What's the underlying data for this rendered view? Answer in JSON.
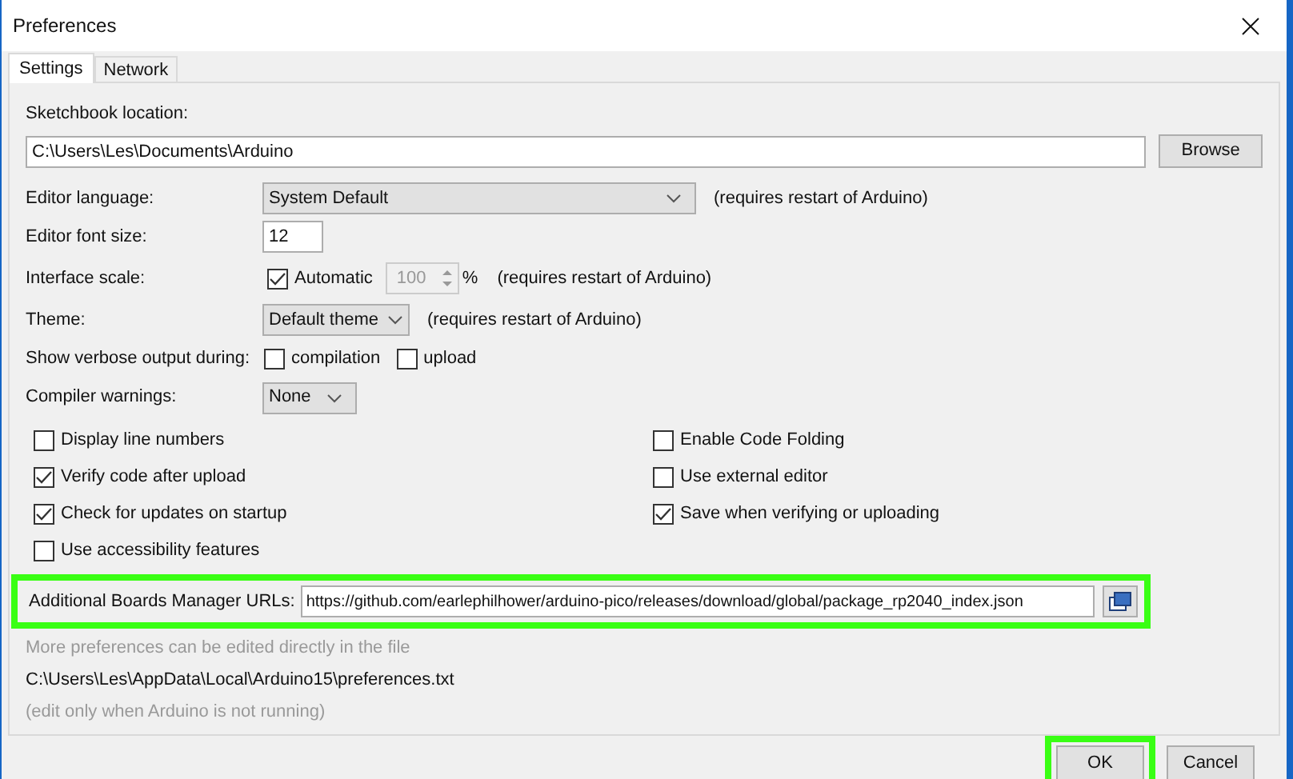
{
  "window": {
    "title": "Preferences"
  },
  "tabs": [
    {
      "label": "Settings",
      "selected": true
    },
    {
      "label": "Network",
      "selected": false
    }
  ],
  "sketchbook": {
    "label": "Sketchbook location:",
    "value": "C:\\Users\\Les\\Documents\\Arduino",
    "button": "Browse"
  },
  "editor_language": {
    "label": "Editor language:",
    "value": "System Default",
    "note": "(requires restart of Arduino)"
  },
  "editor_font_size": {
    "label": "Editor font size:",
    "value": "12"
  },
  "interface_scale": {
    "label": "Interface scale:",
    "automatic": {
      "label": "Automatic",
      "checked": true
    },
    "value": "100",
    "unit": "%",
    "disabled": true,
    "note": "(requires restart of Arduino)"
  },
  "theme": {
    "label": "Theme:",
    "value": "Default theme",
    "note": "(requires restart of Arduino)"
  },
  "verbose_output": {
    "label": "Show verbose output during:",
    "options": [
      {
        "label": "compilation",
        "checked": false
      },
      {
        "label": "upload",
        "checked": false
      }
    ]
  },
  "compiler_warnings": {
    "label": "Compiler warnings:",
    "value": "None"
  },
  "options_left": [
    {
      "label": "Display line numbers",
      "checked": false
    },
    {
      "label": "Verify code after upload",
      "checked": true
    },
    {
      "label": "Check for updates on startup",
      "checked": true
    },
    {
      "label": "Use accessibility features",
      "checked": false
    }
  ],
  "options_right": [
    {
      "label": "Enable Code Folding",
      "checked": false
    },
    {
      "label": "Use external editor",
      "checked": false
    },
    {
      "label": "Save when verifying or uploading",
      "checked": true
    }
  ],
  "boards_manager": {
    "label": "Additional Boards Manager URLs:",
    "value": "https://github.com/earlephilhower/arduino-pico/releases/download/global/package_rp2040_index.json",
    "highlighted": true
  },
  "file_info": {
    "hint": "More preferences can be edited directly in the file",
    "path": "C:\\Users\\Les\\AppData\\Local\\Arduino15\\preferences.txt",
    "note": "(edit only when Arduino is not running)"
  },
  "buttons": [
    {
      "label": "OK",
      "highlighted": true
    },
    {
      "label": "Cancel",
      "highlighted": false
    }
  ]
}
